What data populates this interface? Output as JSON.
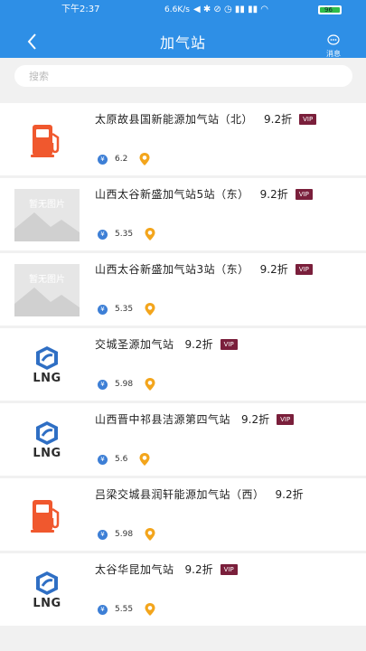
{
  "status_bar": {
    "time": "下午2:37",
    "net_speed": "6.6K/s",
    "signal_icons": "◀ ✱ ⊘ ◷ ▮▮ ▮▮ ◠",
    "battery": "96"
  },
  "header": {
    "title": "加气站",
    "message_label": "消息"
  },
  "search": {
    "placeholder": "搜索"
  },
  "stations": [
    {
      "thumb": "pump-icon",
      "name": "太原故县国新能源加气站（北）",
      "discount": "9.2折",
      "vip": "VIP",
      "price": "6.2"
    },
    {
      "thumb": "placeholder",
      "name": "山西太谷新盛加气站5站（东）",
      "discount": "9.2折",
      "vip": "VIP",
      "price": "5.35"
    },
    {
      "thumb": "placeholder",
      "name": "山西太谷新盛加气站3站（东）",
      "discount": "9.2折",
      "vip": "VIP",
      "price": "5.35"
    },
    {
      "thumb": "lng-logo",
      "name": "交城圣源加气站",
      "discount": "9.2折",
      "vip": "VIP",
      "price": "5.98"
    },
    {
      "thumb": "lng-logo",
      "name": "山西晋中祁县洁源第四气站",
      "discount": "9.2折",
      "vip": "VIP",
      "price": "5.6"
    },
    {
      "thumb": "pump-icon",
      "name": "吕梁交城县润轩能源加气站（西）",
      "discount": "9.2折",
      "vip": "",
      "price": "5.98"
    },
    {
      "thumb": "lng-logo",
      "name": "太谷华昆加气站",
      "discount": "9.2折",
      "vip": "VIP",
      "price": "5.55"
    }
  ],
  "placeholder_text": "暂无图片",
  "lng_label": "LNG",
  "yen_symbol": "¥",
  "colors": {
    "header": "#2e8fe6",
    "vip": "#7a1f3b",
    "location": "#f3a51c",
    "yen": "#3d7fd6",
    "pump": "#f0582e"
  }
}
